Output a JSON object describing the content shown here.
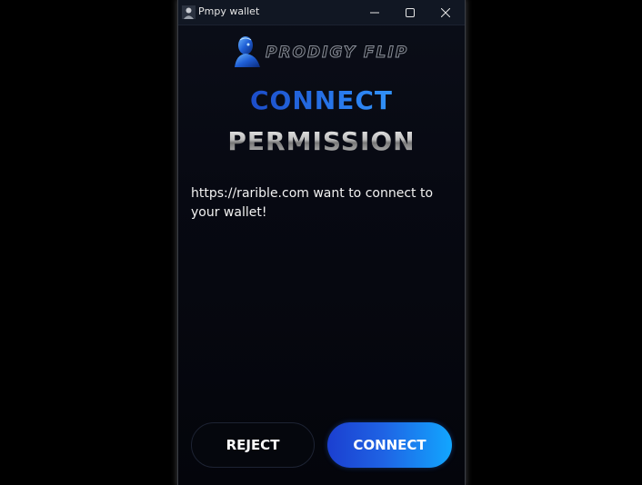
{
  "window": {
    "title": "Pmpy wallet"
  },
  "titlebar_icons": {
    "app": "user-avatar-icon",
    "minimize": "minimize-icon",
    "maximize": "maximize-icon",
    "close": "close-icon"
  },
  "logo": {
    "text": "PRODIGY FLIP",
    "icon": "robot-head-icon"
  },
  "headings": {
    "line1": "CONNECT",
    "line2": "PERMISSION"
  },
  "message": {
    "text": "https://rarible.com want to connect to your wallet!"
  },
  "buttons": {
    "reject_label": "REJECT",
    "connect_label": "CONNECT"
  },
  "colors": {
    "background": "#05070d",
    "accent_start": "#1b3fd0",
    "accent_end": "#12a6ff",
    "heading1_blue": "#2a7ef0",
    "text": "#f2f2f2"
  }
}
